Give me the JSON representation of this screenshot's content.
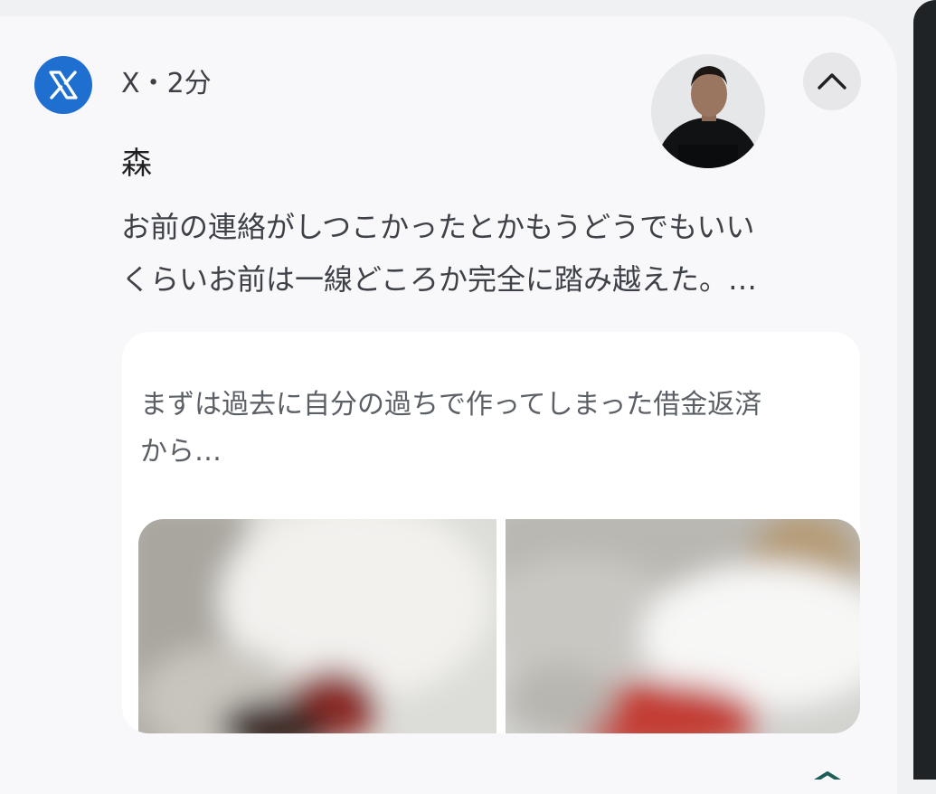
{
  "notification": {
    "app_name": "X",
    "separator": "・",
    "time": "2分",
    "sender": "森",
    "message_line1": "お前の連絡がしつこかったとかもうどうでもいい",
    "message_line2": "くらいお前は一線どころか完全に踏み越えた。…",
    "preview": {
      "line1": "まずは過去に自分の過ちで作ってしまった借金返済",
      "line2": "から…"
    },
    "icons": {
      "app": "x-logo-icon",
      "collapse": "chevron-up-icon",
      "avatar": "profile-photo"
    }
  },
  "colors": {
    "app_icon_bg": "#1f6fd0",
    "card_bg": "#f8f8fa",
    "page_bg": "#f0f1f3",
    "text_primary": "#1f2023",
    "text_secondary": "#3e4147"
  }
}
